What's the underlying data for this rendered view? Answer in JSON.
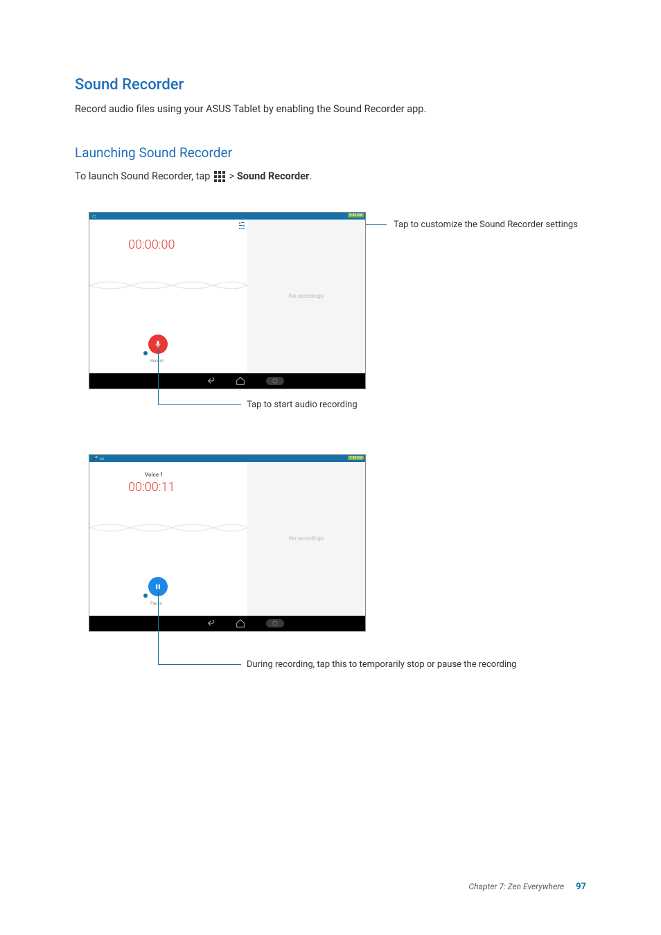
{
  "headings": {
    "h1": "Sound Recorder",
    "h2": "Launching Sound Recorder"
  },
  "body": {
    "intro": "Record audio files using your ASUS Tablet by enabling the Sound Recorder app.",
    "launch_pre": "To launch Sound Recorder, tap ",
    "launch_post": " > ",
    "launch_bold": "Sound Recorder",
    "launch_end": "."
  },
  "screenshot1": {
    "status_time": "9:36 AM",
    "timer": "00:00:00",
    "no_recordings": "No recordings",
    "button_label": "Record"
  },
  "screenshot2": {
    "status_time": "9:38 AM",
    "voice_label": "Voice 1",
    "timer": "00:00:11",
    "no_recordings": "No recordings",
    "button_label": "Pause"
  },
  "callouts": {
    "settings": "Tap to customize the Sound Recorder settings",
    "record": "Tap to start audio recording",
    "pause": "During recording, tap this to temporarily stop or pause the recording"
  },
  "footer": {
    "chapter": "Chapter 7: Zen Everywhere",
    "page": "97"
  }
}
